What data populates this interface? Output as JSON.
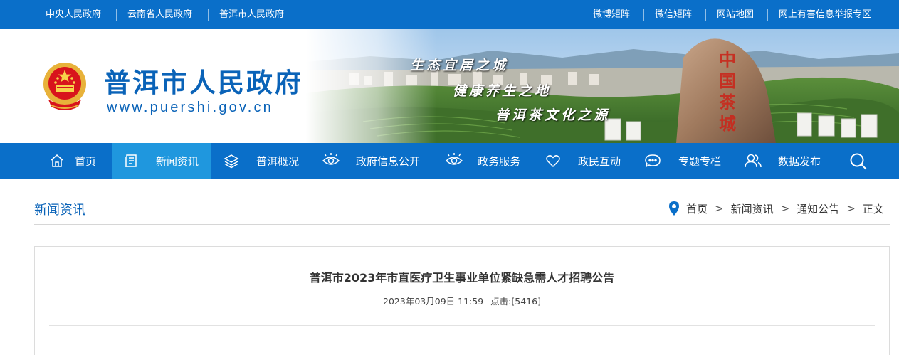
{
  "topbar": {
    "left_links": [
      "中央人民政府",
      "云南省人民政府",
      "普洱市人民政府"
    ],
    "right_links": [
      "微博矩阵",
      "微信矩阵",
      "网站地图",
      "网上有害信息举报专区"
    ]
  },
  "header": {
    "site_title": "普洱市人民政府",
    "site_url": "www.puershi.gov.cn",
    "slogans": [
      "生态宜居之城",
      "健康养生之地",
      "普洱茶文化之源"
    ],
    "rock_text": "中国茶城"
  },
  "nav": {
    "items": [
      {
        "label": "首页",
        "icon": "home-icon"
      },
      {
        "label": "新闻资讯",
        "icon": "news-icon"
      },
      {
        "label": "普洱概况",
        "icon": "layers-icon"
      },
      {
        "label": "政府信息公开",
        "icon": "eye-icon"
      },
      {
        "label": "政务服务",
        "icon": "eye-icon"
      },
      {
        "label": "政民互动",
        "icon": "heart-icon"
      },
      {
        "label": "专题专栏",
        "icon": "chat-icon"
      },
      {
        "label": "数据发布",
        "icon": "users-icon"
      }
    ],
    "active": "新闻资讯",
    "search_icon": "search-icon"
  },
  "section": {
    "title": "新闻资讯",
    "breadcrumb": [
      "首页",
      "新闻资讯",
      "通知公告",
      "正文"
    ],
    "breadcrumb_sep": ">"
  },
  "article": {
    "title": "普洱市2023年市直医疗卫生事业单位紧缺急需人才招聘公告",
    "date": "2023年03月09日 11:59",
    "hits_label": "点击:",
    "hits": "[5416]"
  },
  "colors": {
    "primary_blue": "#0a6fc9",
    "active_nav": "#1f97de",
    "title_blue": "#0a63b8"
  }
}
